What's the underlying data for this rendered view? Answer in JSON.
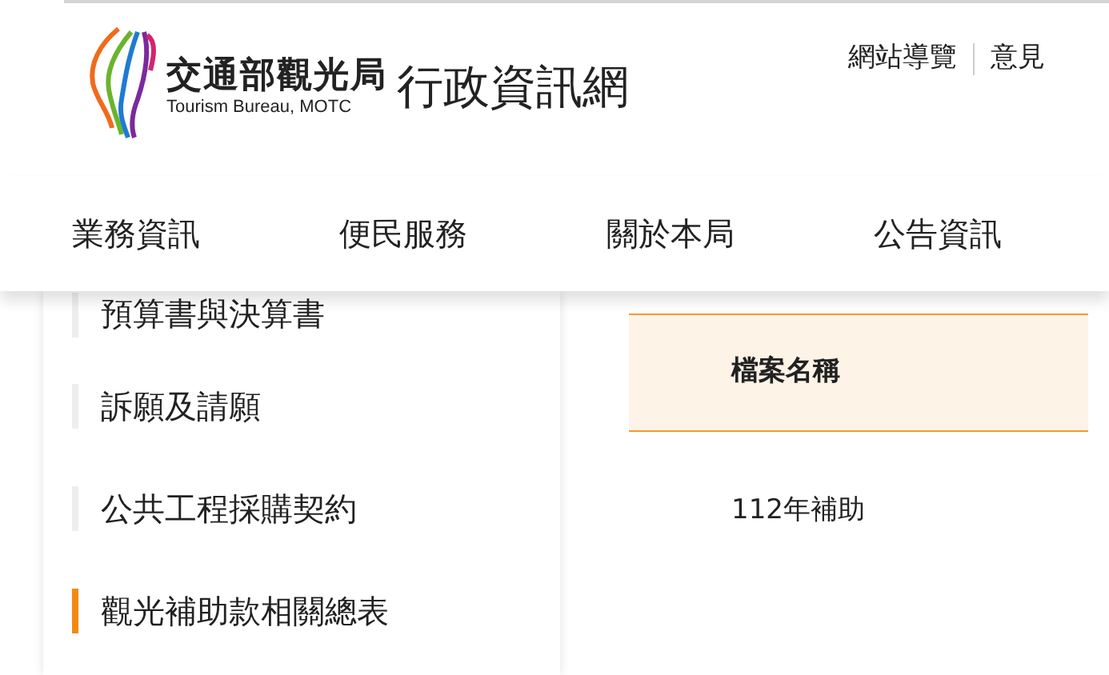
{
  "header": {
    "logo_title": "交通部觀光局",
    "logo_subtitle": "Tourism Bureau, MOTC",
    "site_name": "行政資訊網",
    "top_links": [
      "網站導覽",
      "意見"
    ]
  },
  "nav": [
    "業務資訊",
    "便民服務",
    "關於本局",
    "公告資訊"
  ],
  "sidebar": {
    "items": [
      {
        "label": "預算書與決算書",
        "selected": false
      },
      {
        "label": "訴願及請願",
        "selected": false
      },
      {
        "label": "公共工程採購契約",
        "selected": false
      },
      {
        "label": "觀光補助款相關總表",
        "selected": true
      }
    ]
  },
  "table": {
    "columns": [
      "檔案名稱"
    ],
    "rows": [
      [
        "112年補助"
      ]
    ]
  }
}
